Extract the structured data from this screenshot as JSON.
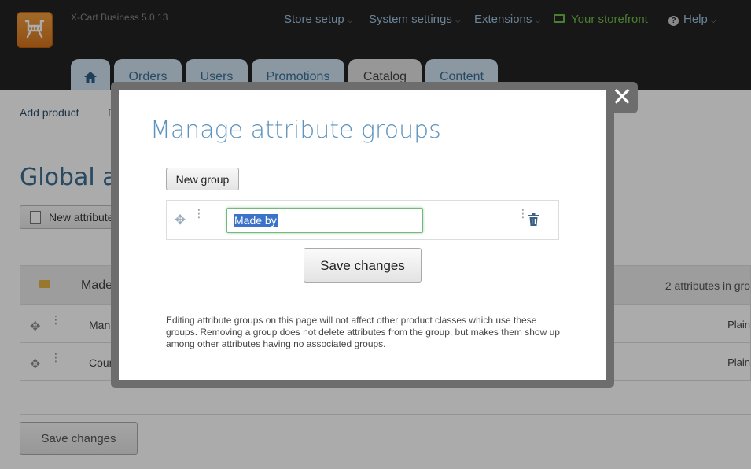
{
  "header": {
    "version": "X-Cart Business 5.0.13",
    "nav": [
      {
        "label": "Store setup"
      },
      {
        "label": "System settings"
      },
      {
        "label": "Extensions"
      },
      {
        "label": "Your storefront"
      },
      {
        "label": "Help"
      }
    ],
    "tabs": [
      {
        "label": "Orders"
      },
      {
        "label": "Users"
      },
      {
        "label": "Promotions"
      },
      {
        "label": "Catalog"
      },
      {
        "label": "Content"
      }
    ]
  },
  "page": {
    "sublinks": [
      "Add product",
      "P"
    ],
    "title": "Global at",
    "new_attribute_label": "New attribute",
    "group": {
      "name": "Made",
      "count_text": "2 attributes in gro"
    },
    "attributes": [
      {
        "name": "Manu",
        "type": "Plain"
      },
      {
        "name": "Cour",
        "type": "Plain"
      }
    ],
    "save_label": "Save changes"
  },
  "modal": {
    "title": "Manage attribute groups",
    "new_group_label": "New group",
    "group_value": "Made by",
    "save_label": "Save changes",
    "note": "Editing attribute groups on this page will not affect other product classes which use these groups. Removing a group does not delete attributes from the group, but makes them show up among other attributes having no associated groups."
  },
  "colors": {
    "accent": "#5d93bc",
    "storefront": "#6fbd4a",
    "selection": "#3b73c8"
  }
}
